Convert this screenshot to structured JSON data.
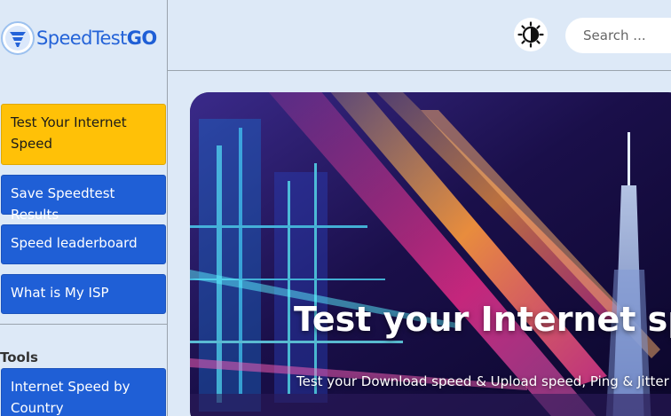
{
  "logo": {
    "text_main": "SpeedTest",
    "text_accent": "GO"
  },
  "header": {
    "theme_toggle_icon": "contrast-icon",
    "search_placeholder": "Search ..."
  },
  "sidebar": {
    "items": [
      {
        "label": "Test Your Internet Speed",
        "active": true
      },
      {
        "label": "Save Speedtest Results",
        "active": false
      },
      {
        "label": "Speed leaderboard",
        "active": false
      },
      {
        "label": "What is My ISP",
        "active": false
      }
    ],
    "tools_heading": "Tools",
    "tools_items": [
      {
        "label": "Internet Speed by Country"
      }
    ]
  },
  "hero": {
    "title": "Test your Internet speed",
    "subtitle": "Test your Download speed & Upload speed, Ping & Jitter (Latency)"
  },
  "colors": {
    "accent_blue": "#1f5fd6",
    "active_yellow": "#ffc107",
    "background": "#dde9f7"
  }
}
